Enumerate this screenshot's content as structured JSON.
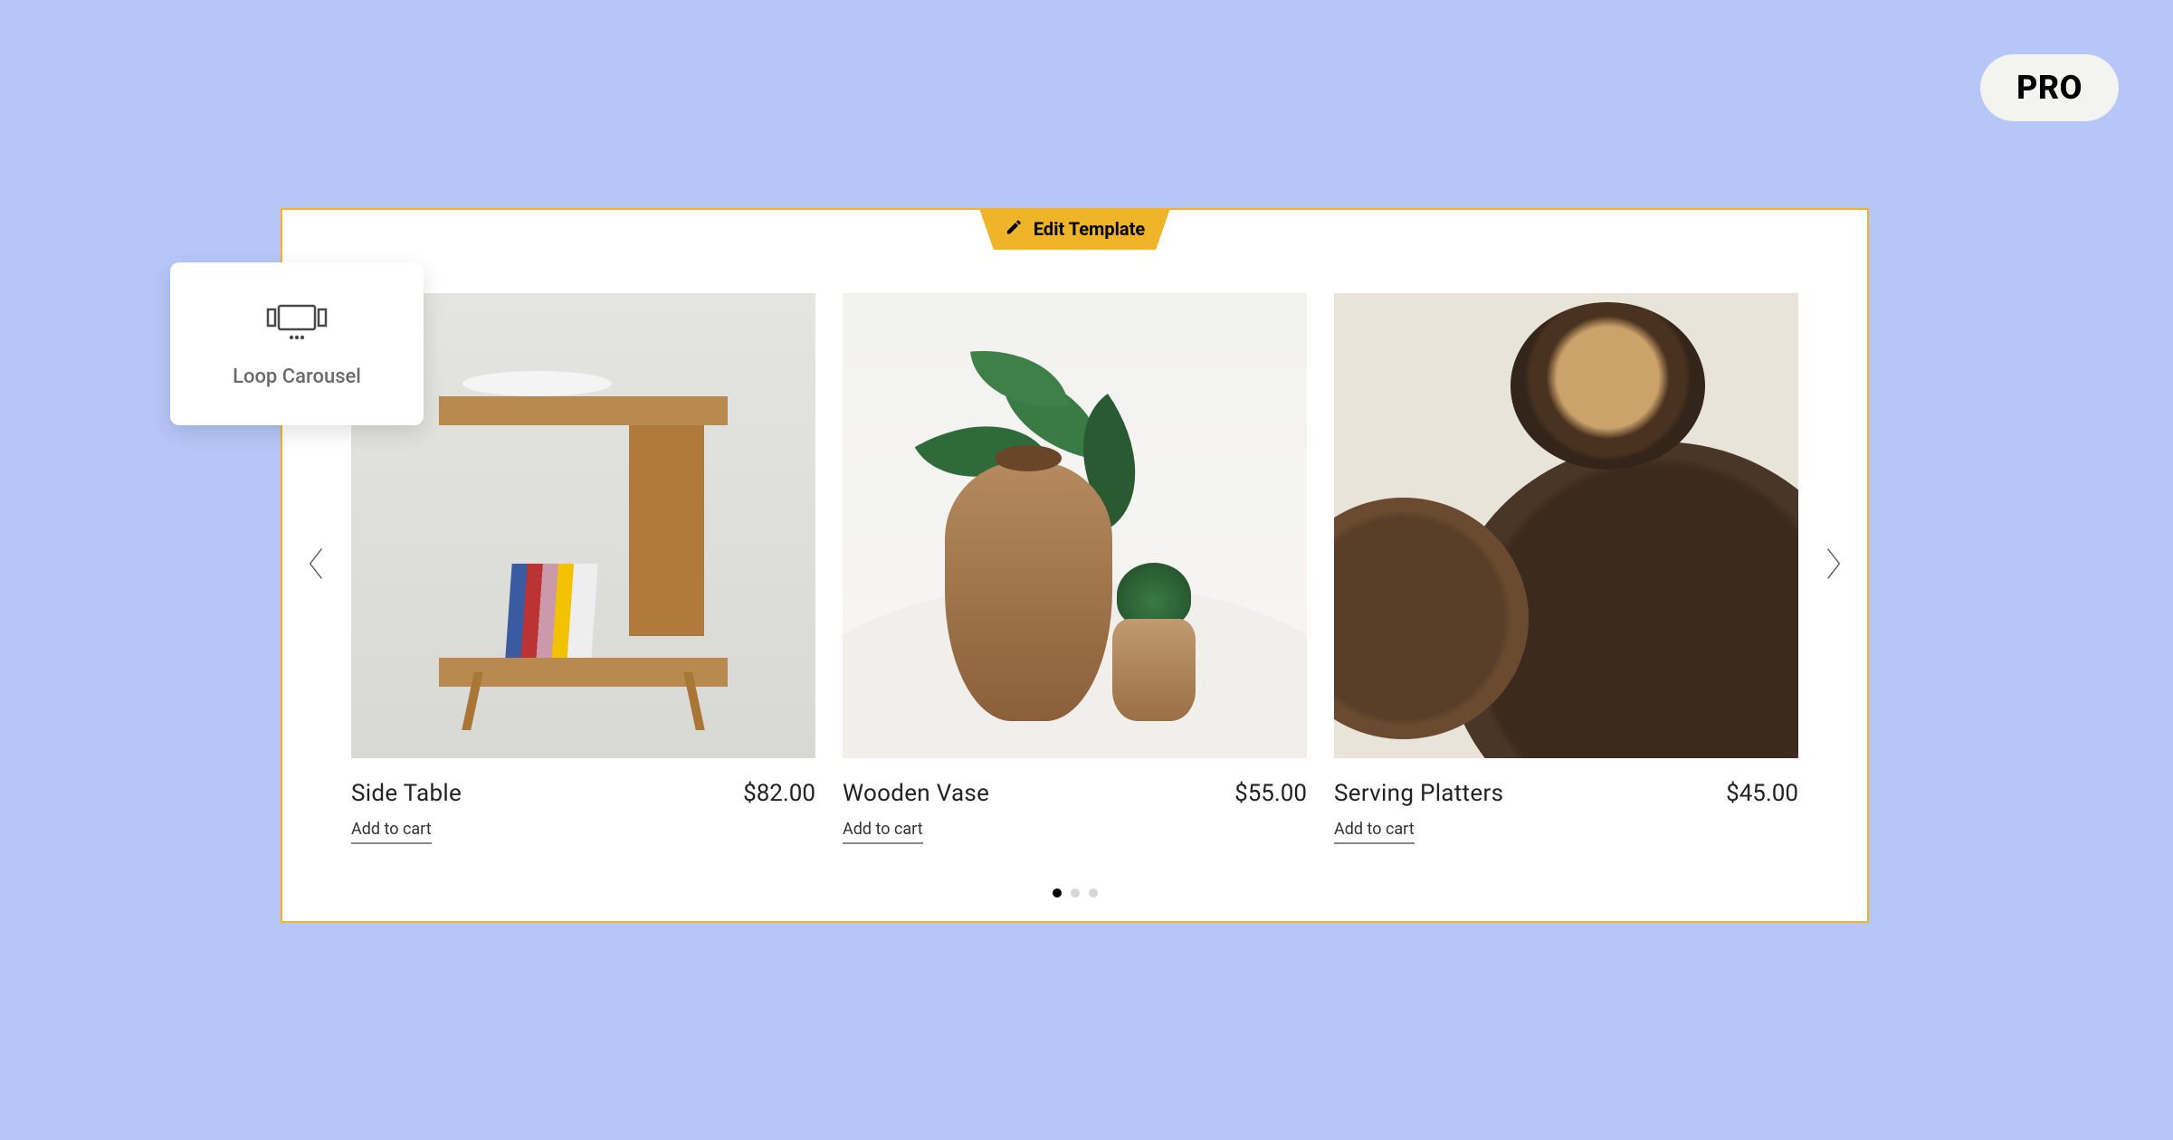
{
  "badge": {
    "label": "PRO"
  },
  "edit_tab": {
    "label": "Edit Template"
  },
  "widget": {
    "label": "Loop Carousel"
  },
  "products": [
    {
      "title": "Side Table",
      "price": "$82.00",
      "cta": "Add to cart"
    },
    {
      "title": "Wooden Vase",
      "price": "$55.00",
      "cta": "Add to cart"
    },
    {
      "title": "Serving Platters",
      "price": "$45.00",
      "cta": "Add to cart"
    }
  ],
  "pagination": {
    "count": 3,
    "active_index": 0
  }
}
